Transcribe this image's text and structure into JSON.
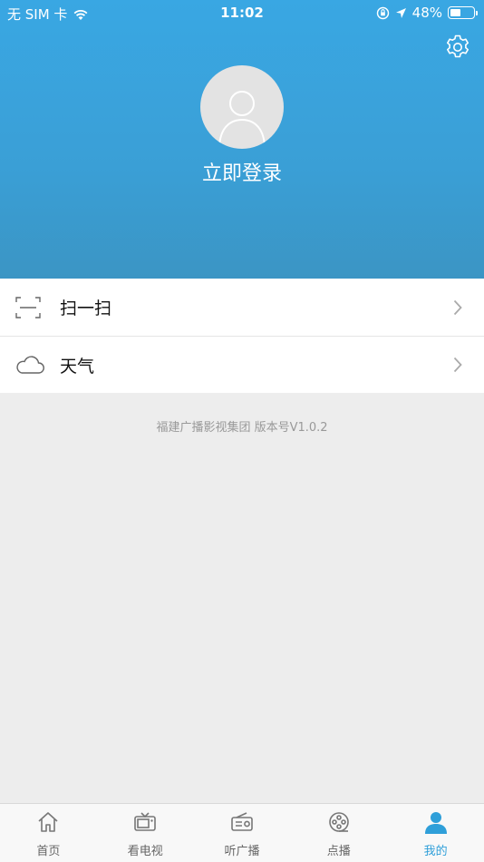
{
  "status_bar": {
    "carrier": "无 SIM 卡",
    "time": "11:02",
    "battery_percent": "48%",
    "battery_level": 0.48
  },
  "header": {
    "login_label": "立即登录"
  },
  "menu": {
    "items": [
      {
        "label": "扫一扫",
        "icon": "scan-icon"
      },
      {
        "label": "天气",
        "icon": "cloud-icon"
      }
    ]
  },
  "footer_text": "福建广播影视集团  版本号V1.0.2",
  "tabbar": {
    "tabs": [
      {
        "label": "首页",
        "icon": "home-icon"
      },
      {
        "label": "看电视",
        "icon": "tv-icon"
      },
      {
        "label": "听广播",
        "icon": "radio-icon"
      },
      {
        "label": "点播",
        "icon": "film-reel-icon"
      },
      {
        "label": "我的",
        "icon": "user-icon",
        "active": true
      }
    ]
  },
  "colors": {
    "accent": "#2f9fd9",
    "header_top": "#39a7e3",
    "header_bottom": "#3b95c4",
    "background": "#ededed"
  }
}
